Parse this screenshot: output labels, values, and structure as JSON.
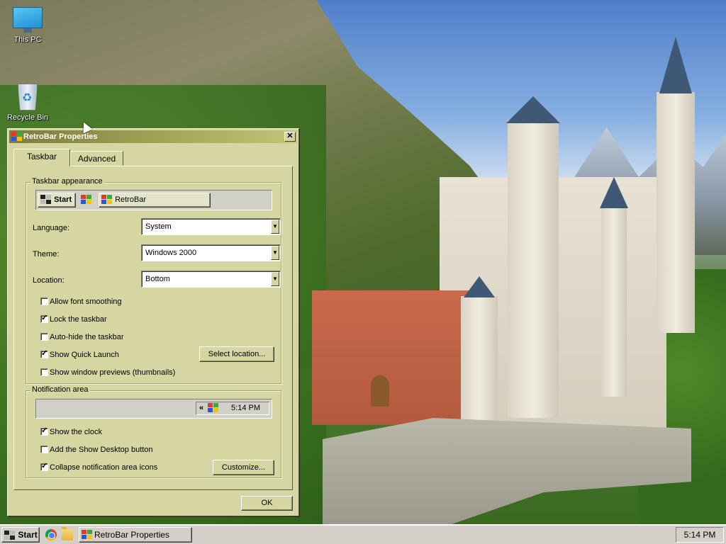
{
  "desktop": {
    "icons": [
      {
        "label": "This PC",
        "icon": "computer-icon"
      },
      {
        "label": "Recycle Bin",
        "icon": "recycle-bin-icon"
      }
    ]
  },
  "window": {
    "title": "RetroBar Properties",
    "close_glyph": "✕",
    "tabs": [
      {
        "label": "Taskbar",
        "active": true
      },
      {
        "label": "Advanced",
        "active": false
      }
    ],
    "appearance": {
      "group_label": "Taskbar appearance",
      "preview": {
        "start_label": "Start",
        "task_label": "RetroBar"
      },
      "language": {
        "label": "Language:",
        "value": "System"
      },
      "theme": {
        "label": "Theme:",
        "value": "Windows 2000"
      },
      "location": {
        "label": "Location:",
        "value": "Bottom"
      },
      "options": [
        {
          "label": "Allow font smoothing",
          "checked": false
        },
        {
          "label": "Lock the taskbar",
          "checked": true
        },
        {
          "label": "Auto-hide the taskbar",
          "checked": false
        },
        {
          "label": "Show Quick Launch",
          "checked": true
        },
        {
          "label": "Show window previews (thumbnails)",
          "checked": false
        }
      ],
      "select_location_label": "Select location..."
    },
    "notification": {
      "group_label": "Notification area",
      "preview_expand": "«",
      "preview_time": "5:14 PM",
      "options": [
        {
          "label": "Show the clock",
          "checked": true
        },
        {
          "label": "Add the Show Desktop button",
          "checked": false
        },
        {
          "label": "Collapse notification area icons",
          "checked": true
        }
      ],
      "customize_label": "Customize..."
    },
    "ok_label": "OK",
    "check_glyph": "✓"
  },
  "taskbar": {
    "start_label": "Start",
    "quick_launch": [
      "chrome-icon",
      "file-explorer-icon"
    ],
    "tasks": [
      {
        "label": "RetroBar Properties"
      }
    ],
    "clock": "5:14 PM"
  },
  "colors": {
    "window_face": "#d6d6a2",
    "title_start": "#7c7c3e",
    "title_end": "#c4c47a",
    "taskbar_face": "#d4d0c8"
  }
}
